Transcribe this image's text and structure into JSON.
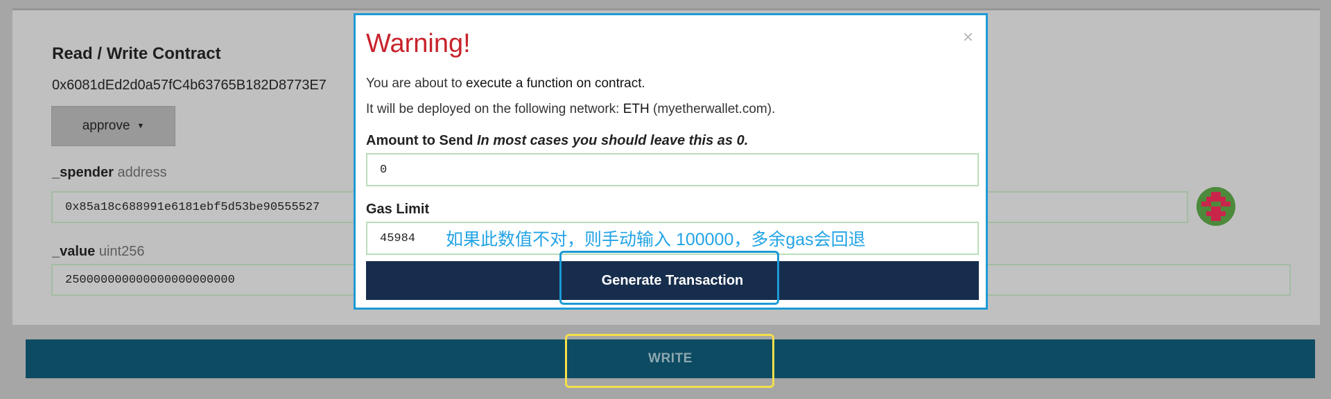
{
  "contract": {
    "title": "Read / Write Contract",
    "address": "0x6081dEd2d0a57fC4b63765B182D8773E7",
    "function_select": "approve"
  },
  "params": {
    "spender": {
      "name": "_spender",
      "type": "address",
      "value": "0x85a18c688991e6181ebf5d53be90555527"
    },
    "value": {
      "name": "_value",
      "type": "uint256",
      "value": "250000000000000000000000"
    }
  },
  "write_button": "WRITE",
  "modal": {
    "title": "Warning!",
    "close": "×",
    "line1_prefix": "You are about to ",
    "line1_strong": "execute a function on contract",
    "line1_suffix": ".",
    "line2_prefix": "It will be deployed on the following network: ",
    "line2_strong": "ETH",
    "line2_suffix": " (myetherwallet.com).",
    "amount_label": "Amount to Send",
    "amount_hint": "In most cases you should leave this as 0.",
    "amount_value": "0",
    "gas_label": "Gas Limit",
    "gas_value": "45984",
    "gas_annotation": "如果此数值不对，则手动输入 100000，多余gas会回退",
    "generate_button": "Generate Transaction"
  },
  "colors": {
    "warning_title": "#c8222b",
    "modal_border": "#1c9ad6",
    "generate_button_bg": "#172d4d",
    "write_button_bg": "#0d4b62",
    "highlight_yellow": "#f4e04a",
    "annotation_blue": "#23a3e6"
  },
  "icons": {
    "close": "close-icon",
    "caret": "caret-down-icon",
    "identicon": "identicon-avatar"
  }
}
